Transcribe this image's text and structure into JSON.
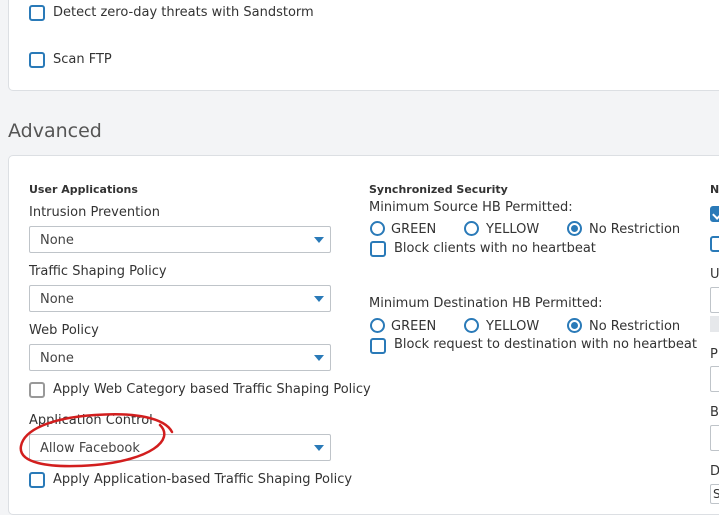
{
  "top": {
    "sandstorm_label": "Detect zero-day threats with Sandstorm",
    "scan_ftp_label": "Scan FTP"
  },
  "section_title": "Advanced",
  "user_apps": {
    "heading": "User Applications",
    "intrusion_label": "Intrusion Prevention",
    "intrusion_value": "None",
    "traffic_label": "Traffic Shaping Policy",
    "traffic_value": "None",
    "web_policy_label": "Web Policy",
    "web_policy_value": "None",
    "web_cat_tsp_label": "Apply Web Category based Traffic Shaping Policy",
    "app_control_label": "Application Control",
    "app_control_value": "Allow Facebook",
    "app_tsp_label": "Apply Application-based Traffic Shaping Policy"
  },
  "sync_sec": {
    "heading": "Synchronized Security",
    "min_source_label": "Minimum Source HB Permitted:",
    "min_dest_label": "Minimum Destination HB Permitted:",
    "opt_green": "GREEN",
    "opt_yellow": "YELLOW",
    "opt_none": "No Restriction",
    "block_clients_label": "Block clients with no heartbeat",
    "block_request_label": "Block request to destination with no heartbeat"
  },
  "nat": {
    "heading_partial": "N",
    "u_partial": "U",
    "p_partial": "P",
    "b_partial": "B",
    "d_partial": "D",
    "s_partial": "S"
  },
  "colors": {
    "accent": "#2a7ab8",
    "annotation": "#d21e1e"
  }
}
